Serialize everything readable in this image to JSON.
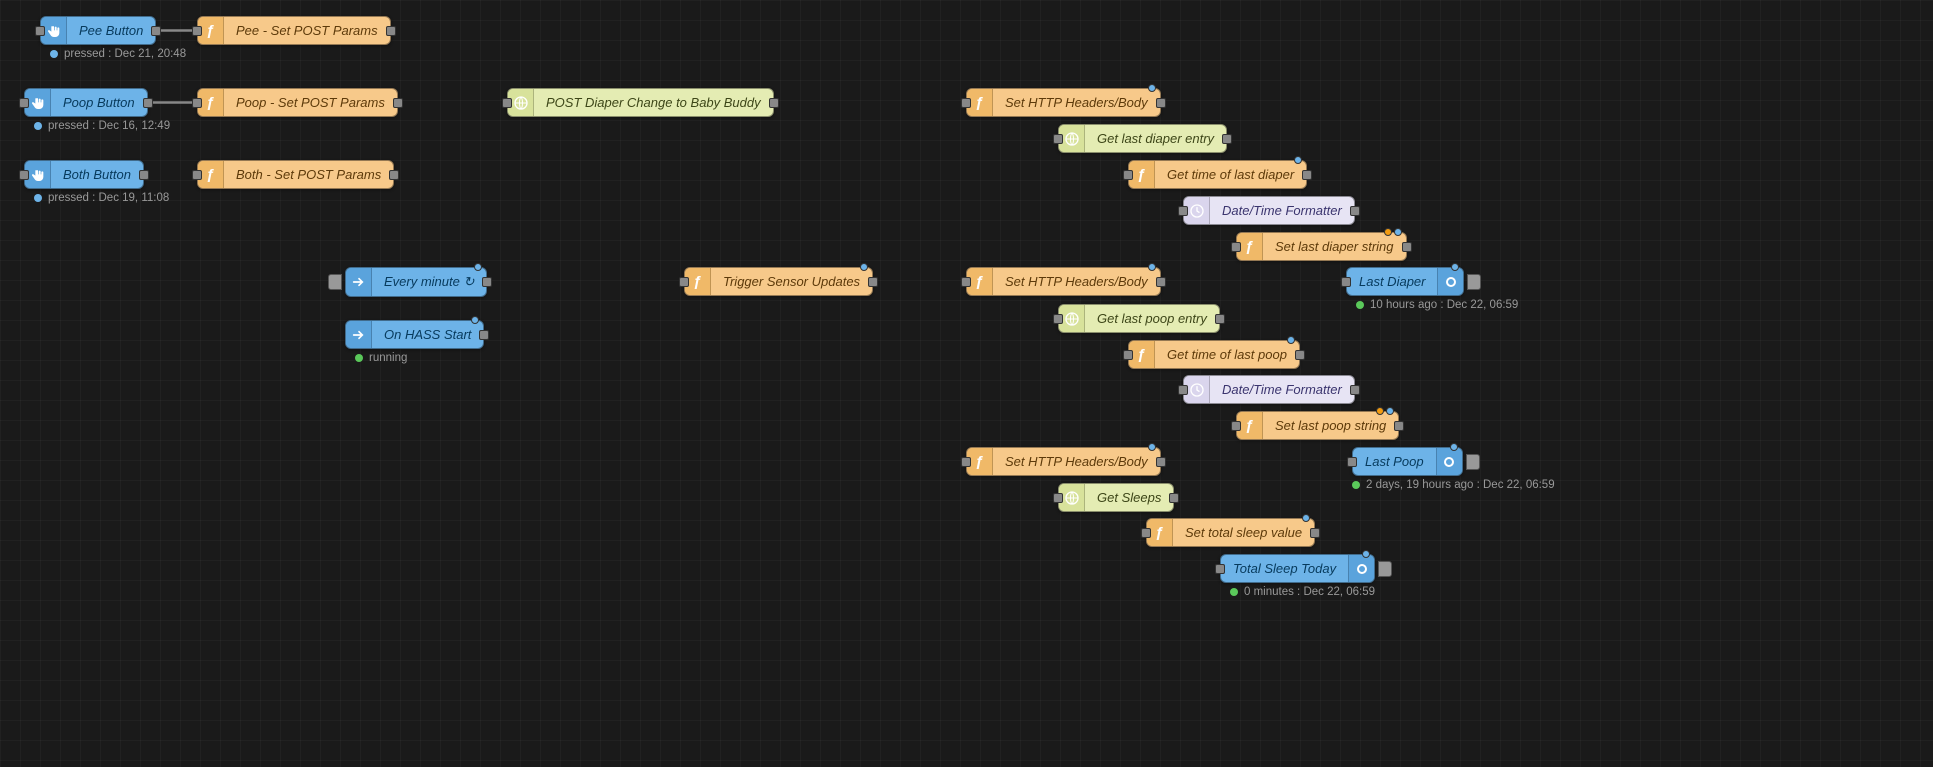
{
  "nodes": {
    "pee_button": {
      "label": "Pee Button",
      "status": "pressed : Dec 21, 20:48"
    },
    "poop_button": {
      "label": "Poop Button",
      "status": "pressed : Dec 16, 12:49"
    },
    "both_button": {
      "label": "Both Button",
      "status": "pressed : Dec 19, 11:08"
    },
    "pee_set_params": {
      "label": "Pee - Set POST Params"
    },
    "poop_set_params": {
      "label": "Poop - Set POST Params"
    },
    "both_set_params": {
      "label": "Both - Set POST Params"
    },
    "post_diaper": {
      "label": "POST Diaper Change to Baby Buddy"
    },
    "every_minute": {
      "label": "Every minute ↻"
    },
    "on_hass_start": {
      "label": "On HASS Start",
      "status": "running"
    },
    "trigger_sensor": {
      "label": "Trigger Sensor Updates"
    },
    "set_http1": {
      "label": "Set HTTP Headers/Body"
    },
    "get_last_diaper_entry": {
      "label": "Get last diaper entry"
    },
    "get_time_last_diaper": {
      "label": "Get time of last diaper"
    },
    "dt_formatter1": {
      "label": "Date/Time Formatter"
    },
    "set_last_diaper_string": {
      "label": "Set last diaper string"
    },
    "last_diaper": {
      "label": "Last Diaper",
      "status": "10 hours ago : Dec 22, 06:59"
    },
    "set_http2": {
      "label": "Set HTTP Headers/Body"
    },
    "get_last_poop_entry": {
      "label": "Get last poop entry"
    },
    "get_time_last_poop": {
      "label": "Get time of last poop"
    },
    "dt_formatter2": {
      "label": "Date/Time Formatter"
    },
    "set_last_poop_string": {
      "label": "Set last poop string"
    },
    "last_poop": {
      "label": "Last Poop",
      "status": "2 days, 19 hours ago : Dec 22, 06:59"
    },
    "set_http3": {
      "label": "Set HTTP Headers/Body"
    },
    "get_sleeps": {
      "label": "Get Sleeps"
    },
    "set_total_sleep": {
      "label": "Set total sleep value"
    },
    "total_sleep_today": {
      "label": "Total Sleep Today",
      "status": "0 minutes : Dec 22, 06:59"
    }
  },
  "wires": [
    {
      "from": "pee_button",
      "to": "pee_set_params"
    },
    {
      "from": "poop_button",
      "to": "poop_set_params"
    },
    {
      "from": "both_button",
      "to": "both_set_params"
    },
    {
      "from": "pee_set_params",
      "to": "post_diaper"
    },
    {
      "from": "poop_set_params",
      "to": "post_diaper"
    },
    {
      "from": "both_set_params",
      "to": "post_diaper"
    },
    {
      "from": "post_diaper",
      "to": "trigger_sensor"
    },
    {
      "from": "every_minute",
      "to": "trigger_sensor"
    },
    {
      "from": "on_hass_start",
      "to": "trigger_sensor"
    },
    {
      "from": "trigger_sensor",
      "to": "set_http1"
    },
    {
      "from": "trigger_sensor",
      "to": "set_http2"
    },
    {
      "from": "trigger_sensor",
      "to": "set_http3"
    },
    {
      "from": "set_http1",
      "to": "get_last_diaper_entry"
    },
    {
      "from": "get_last_diaper_entry",
      "to": "get_time_last_diaper"
    },
    {
      "from": "get_time_last_diaper",
      "to": "dt_formatter1"
    },
    {
      "from": "dt_formatter1",
      "to": "set_last_diaper_string"
    },
    {
      "from": "set_last_diaper_string",
      "to": "last_diaper"
    },
    {
      "from": "set_http2",
      "to": "get_last_poop_entry"
    },
    {
      "from": "get_last_poop_entry",
      "to": "get_time_last_poop"
    },
    {
      "from": "get_time_last_poop",
      "to": "dt_formatter2"
    },
    {
      "from": "dt_formatter2",
      "to": "set_last_poop_string"
    },
    {
      "from": "set_last_poop_string",
      "to": "last_poop"
    },
    {
      "from": "set_http3",
      "to": "get_sleeps"
    },
    {
      "from": "get_sleeps",
      "to": "set_total_sleep"
    },
    {
      "from": "set_total_sleep",
      "to": "total_sleep_today"
    }
  ]
}
